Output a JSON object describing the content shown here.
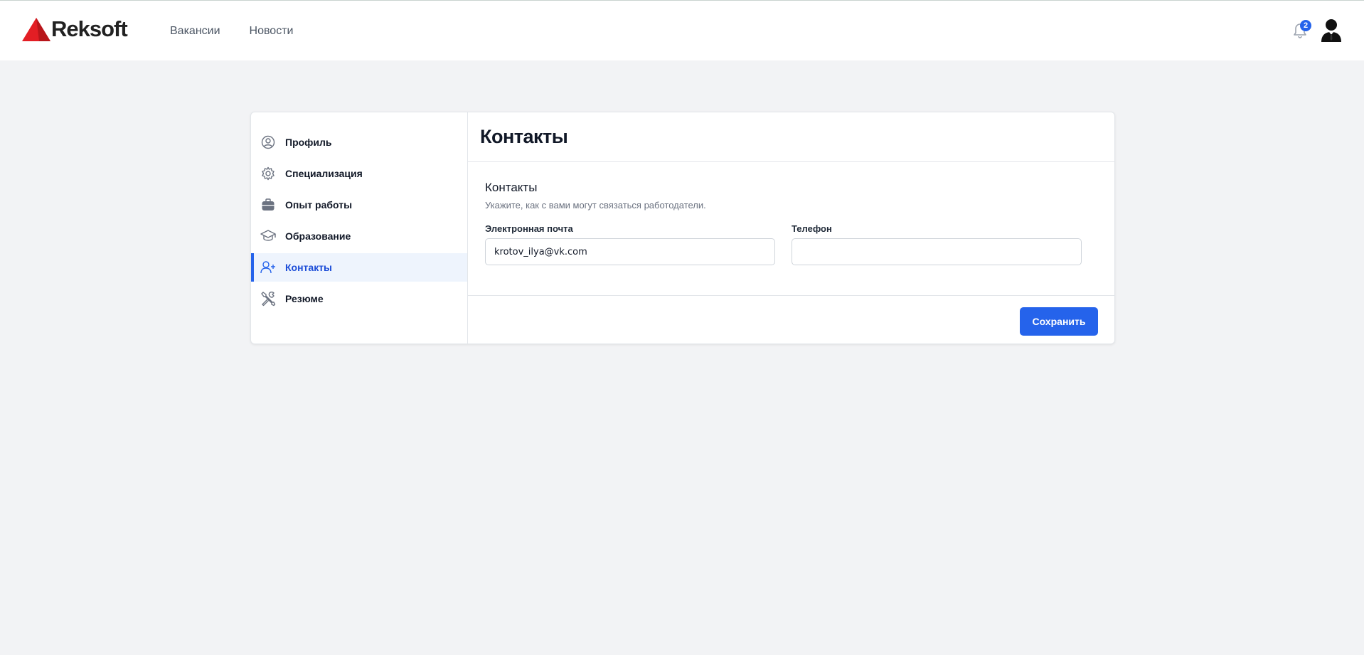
{
  "brand": {
    "name": "Reksoft",
    "logo_color": "#e31e24"
  },
  "nav": {
    "vacancies": "Вакансии",
    "news": "Новости"
  },
  "header": {
    "notifications_count": "2"
  },
  "sidebar": {
    "items": [
      {
        "label": "Профиль",
        "icon": "user-circle-icon"
      },
      {
        "label": "Специализация",
        "icon": "gear-icon"
      },
      {
        "label": "Опыт работы",
        "icon": "briefcase-icon"
      },
      {
        "label": "Образование",
        "icon": "graduation-cap-icon"
      },
      {
        "label": "Контакты",
        "icon": "user-plus-icon",
        "active": true
      },
      {
        "label": "Резюме",
        "icon": "tools-icon"
      }
    ]
  },
  "main": {
    "title": "Контакты",
    "section_title": "Контакты",
    "section_description": "Укажите, как с вами могут связаться работодатели.",
    "email_label": "Электронная почта",
    "email_value": "krotov_ilya@vk.com",
    "phone_label": "Телефон",
    "phone_value": "",
    "save_label": "Сохранить"
  },
  "colors": {
    "accent": "#2563eb",
    "background": "#f2f3f5"
  }
}
